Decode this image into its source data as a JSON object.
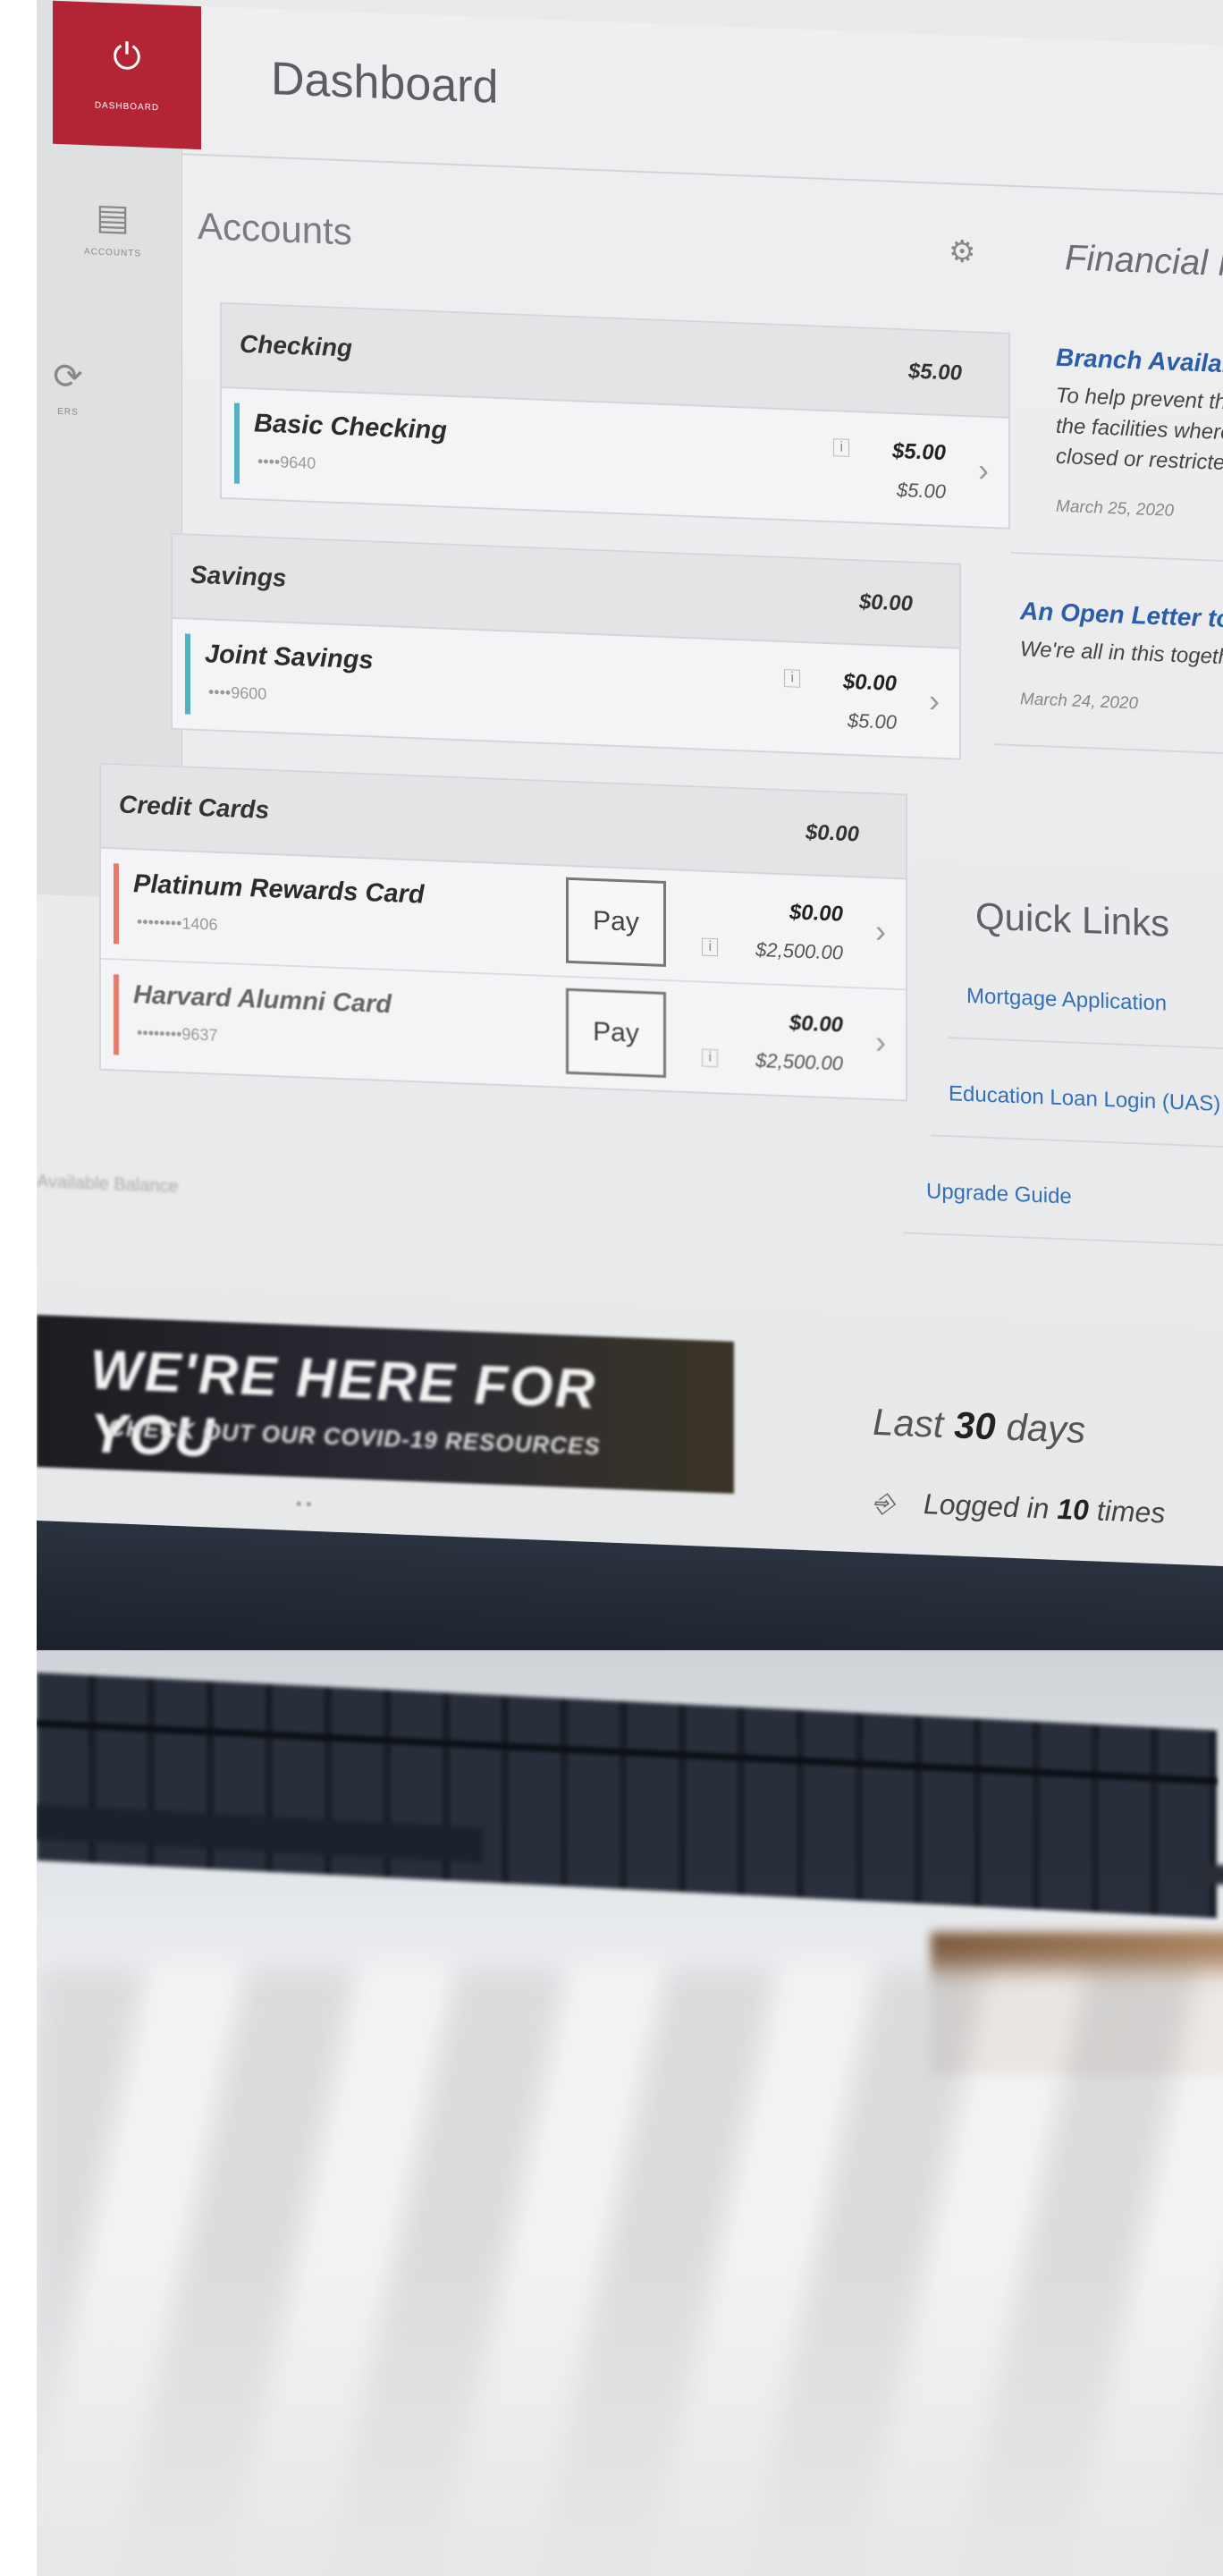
{
  "nav": {
    "dashboard_label": "DASHBOARD",
    "accounts_label": "ACCOUNTS",
    "transfers_label": "ERS",
    "icons": [
      "power-icon",
      "accounts-icon",
      "transfer-icon"
    ]
  },
  "header": {
    "title": "Dashboard"
  },
  "accounts": {
    "title": "Accounts",
    "groups": [
      {
        "name": "Checking",
        "total": "$5.00",
        "items": [
          {
            "name": "Basic Checking",
            "number": "••••9640",
            "balance": "$5.00",
            "available": "$5.00",
            "color": "#4fb3c4"
          }
        ]
      },
      {
        "name": "Savings",
        "total": "$0.00",
        "items": [
          {
            "name": "Joint Savings",
            "number": "••••9600",
            "balance": "$0.00",
            "available": "$5.00",
            "color": "#4fb3c4"
          }
        ]
      },
      {
        "name": "Credit Cards",
        "total": "$0.00",
        "items": [
          {
            "name": "Platinum Rewards Card",
            "number": "••••••••1406",
            "balance": "$0.00",
            "available": "$2,500.00",
            "color": "#e8796a",
            "pay": "Pay"
          },
          {
            "name": "Harvard Alumni Card",
            "number": "••••••••9637",
            "balance": "$0.00",
            "available": "$2,500.00",
            "color": "#e8796a",
            "pay": "Pay"
          }
        ]
      }
    ],
    "available_label": "Available Balance"
  },
  "news": {
    "title": "Financial Ne",
    "items": [
      {
        "headline": "Branch Availabil",
        "body_lines": [
          "To help prevent the",
          "the facilities where c",
          "closed or restricted a"
        ],
        "date": "March 25, 2020"
      },
      {
        "headline": "An Open Letter to Ou",
        "body_lines": [
          "We're all in this together."
        ],
        "date": "March 24, 2020"
      }
    ]
  },
  "quick_links": {
    "title": "Quick Links",
    "items": [
      "Mortgage Application",
      "Education Loan Login (UAS)",
      "Upgrade Guide"
    ]
  },
  "banner": {
    "headline": "WE'RE HERE FOR YOU",
    "sub": "CHECK OUT OUR COVID-19 RESOURCES",
    "dots": "•  •"
  },
  "activity": {
    "prefix": "Last",
    "days": "30",
    "suffix": "days",
    "logged_prefix": "Logged in",
    "logged_count": "10",
    "logged_suffix": "times"
  },
  "colors": {
    "brand": "#b32434",
    "link": "#3470b8"
  }
}
